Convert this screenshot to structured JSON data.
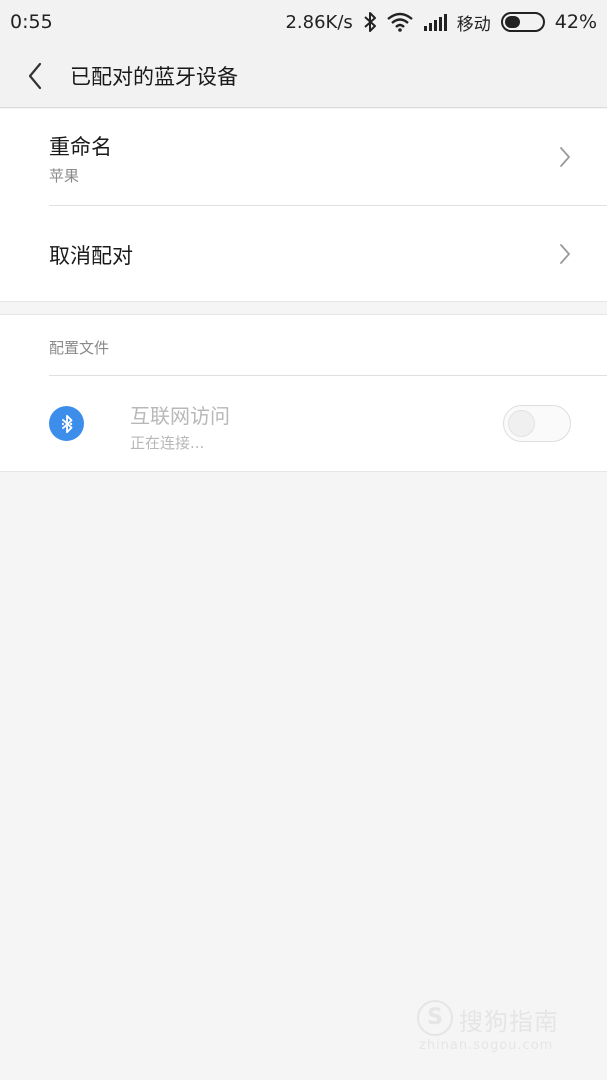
{
  "status_bar": {
    "time": "0:55",
    "net_speed": "2.86K/s",
    "carrier": "移动",
    "battery_percent_text": "42%",
    "battery_level": 0.42,
    "icons": [
      "bluetooth-icon",
      "wifi-icon",
      "signal-icon",
      "battery-icon"
    ]
  },
  "header": {
    "back_icon": "chevron-left-icon",
    "title": "已配对的蓝牙设备"
  },
  "settings": {
    "rename": {
      "label": "重命名",
      "value": "苹果"
    },
    "unpair": {
      "label": "取消配对"
    }
  },
  "profiles": {
    "section_title": "配置文件",
    "items": [
      {
        "icon": "bluetooth-icon",
        "name": "互联网访问",
        "status": "正在连接...",
        "enabled": false
      }
    ]
  },
  "watermark": {
    "logo_letter": "S",
    "brand": "搜狗指南",
    "url": "zhinan.sogou.com"
  },
  "colors": {
    "accent": "#3d8eea",
    "background": "#f5f5f5",
    "header_bg": "#f2f2f2",
    "card_bg": "#ffffff",
    "disabled_text": "#b8b8b8",
    "secondary_text": "#8a8a8a"
  }
}
